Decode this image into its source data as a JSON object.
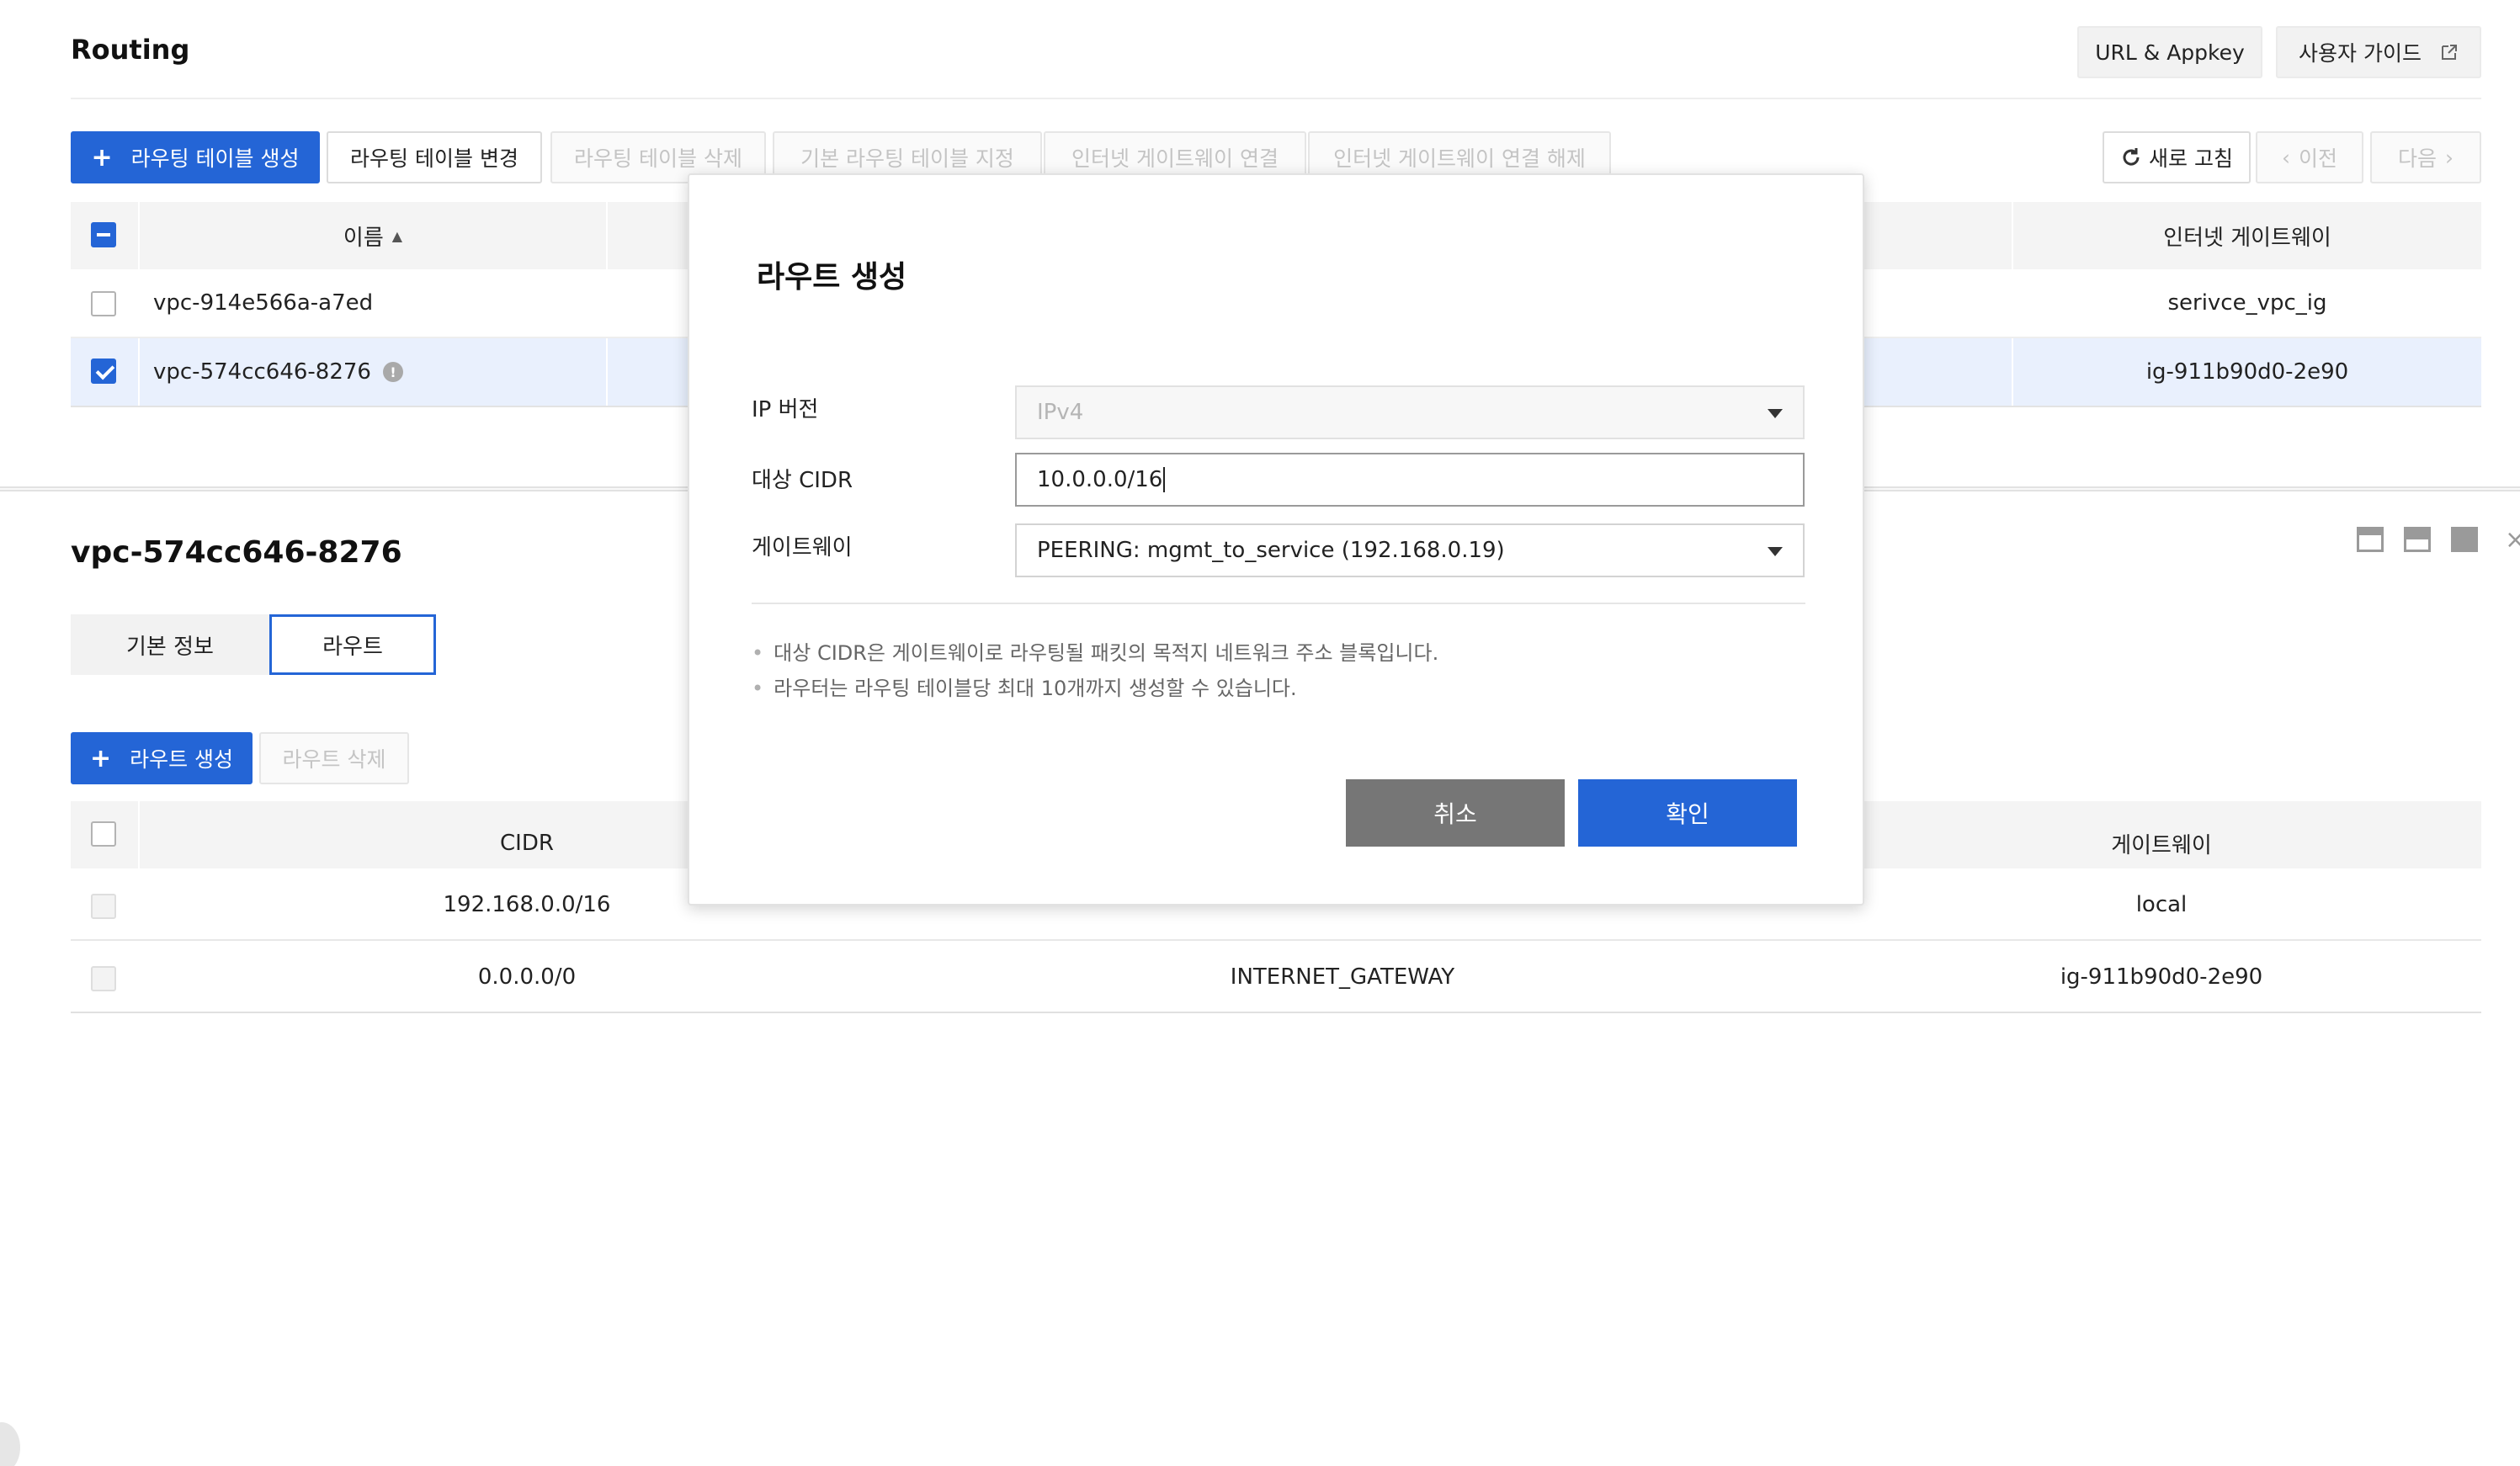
{
  "header": {
    "title": "Routing",
    "url_appkey_label": "URL & Appkey",
    "user_guide_label": "사용자 가이드"
  },
  "toolbar": {
    "create_table": "라우팅 테이블 생성",
    "change_table": "라우팅 테이블 변경",
    "delete_table": "라우팅 테이블 삭제",
    "set_default": "기본 라우팅 테이블 지정",
    "connect_igw": "인터넷 게이트웨이 연결",
    "disconnect_igw": "인터넷 게이트웨이 연결 해제",
    "refresh": "새로 고침",
    "prev": "이전",
    "next": "다음"
  },
  "routing_table": {
    "columns": {
      "name": "이름",
      "igw": "인터넷 게이트웨이"
    },
    "rows": [
      {
        "name": "vpc-914e566a-a7ed",
        "igw": "serivce_vpc_ig",
        "checked": false
      },
      {
        "name": "vpc-574cc646-8276",
        "igw": "ig-911b90d0-2e90",
        "checked": true
      }
    ]
  },
  "detail": {
    "title": "vpc-574cc646-8276",
    "tabs": [
      "기본 정보",
      "라우트"
    ],
    "active_tab": 1,
    "create_route": "라우트 생성",
    "delete_route": "라우트 삭제",
    "columns": {
      "cidr": "CIDR",
      "gateway": "게이트웨이"
    },
    "rows": [
      {
        "cidr": "192.168.0.0/16",
        "type": "",
        "gateway": "local"
      },
      {
        "cidr": "0.0.0.0/0",
        "type": "INTERNET_GATEWAY",
        "gateway": "ig-911b90d0-2e90"
      }
    ]
  },
  "modal": {
    "title": "라우트 생성",
    "ip_version_label": "IP 버전",
    "ip_version_value": "IPv4",
    "cidr_label": "대상 CIDR",
    "cidr_value": "10.0.0.0/16",
    "gateway_label": "게이트웨이",
    "gateway_value": "PEERING: mgmt_to_service (192.168.0.19)",
    "notes": [
      "대상 CIDR은 게이트웨이로 라우팅될 패킷의 목적지 네트워크 주소 블록입니다.",
      "라우터는 라우팅 테이블당 최대 10개까지 생성할 수 있습니다."
    ],
    "cancel": "취소",
    "confirm": "확인"
  },
  "colors": {
    "primary": "#2465d6",
    "selected_row": "#e9f0fd",
    "cancel": "#767676"
  },
  "icons": [
    "external-link-icon",
    "refresh-icon",
    "chevron-left-icon",
    "chevron-right-icon",
    "sort-icon",
    "info-icon",
    "panel-layout-icon",
    "caret-down-icon",
    "plus-icon"
  ]
}
